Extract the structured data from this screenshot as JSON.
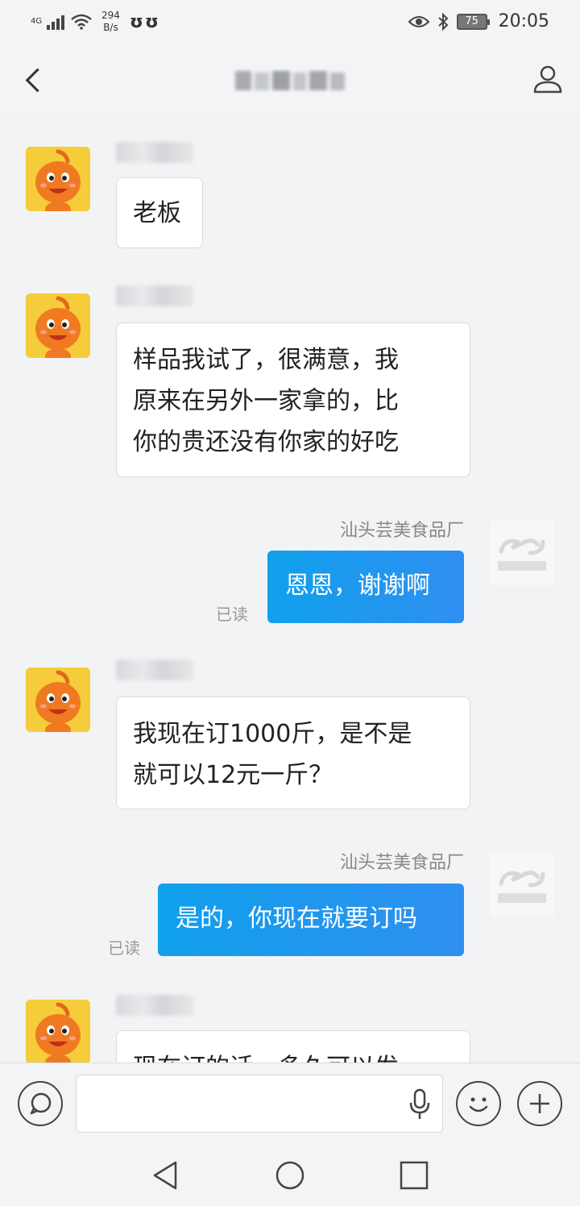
{
  "status_bar": {
    "network": "4G",
    "speed_value": "294",
    "speed_unit": "B/s",
    "notifications": "ʊʊ",
    "battery": "75",
    "time": "20:05"
  },
  "header": {
    "back_icon": "back-arrow",
    "profile_icon": "person-icon"
  },
  "messages": [
    {
      "side": "in",
      "text": "老板"
    },
    {
      "side": "in",
      "lines": [
        "样品我试了，很满意，我",
        "原来在另外一家拿的，比",
        "你的贵还没有你家的好吃"
      ]
    },
    {
      "side": "out",
      "sender": "汕头芸美食品厂",
      "text": "恩恩，谢谢啊",
      "status": "已读"
    },
    {
      "side": "in",
      "lines": [
        "我现在订1000斤，是不是",
        "就可以12元一斤？"
      ]
    },
    {
      "side": "out",
      "sender": "汕头芸美食品厂",
      "text": "是的，你现在就要订吗",
      "status": "已读"
    },
    {
      "side": "in",
      "text": "现在订的话，多久可以发"
    }
  ],
  "input_bar": {
    "chat_icon": "speech-bubble-icon",
    "input_value": "",
    "mic_icon": "microphone-icon",
    "emoji_icon": "smiley-icon",
    "plus_icon": "plus-icon"
  },
  "nav": {
    "back": "triangle-back-icon",
    "home": "circle-home-icon",
    "recents": "square-recents-icon"
  },
  "colors": {
    "outgoing_bubble": "#1aa0ea",
    "avatar_bg": "#f5cd3a",
    "background": "#f2f3f5"
  }
}
